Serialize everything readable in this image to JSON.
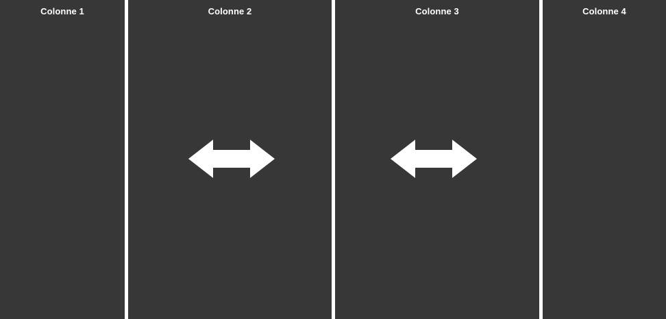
{
  "columns": [
    {
      "title": "Colonne 1",
      "has_resize_handle": false
    },
    {
      "title": "Colonne 2",
      "has_resize_handle": true,
      "handle_icon": "double-arrow-horizontal-icon"
    },
    {
      "title": "Colonne 3",
      "has_resize_handle": true,
      "handle_icon": "double-arrow-horizontal-icon"
    },
    {
      "title": "Colonne 4",
      "has_resize_handle": false
    }
  ],
  "colors": {
    "column_background": "#373737",
    "separator": "#ffffff",
    "text": "#ffffff",
    "icon": "#ffffff"
  }
}
